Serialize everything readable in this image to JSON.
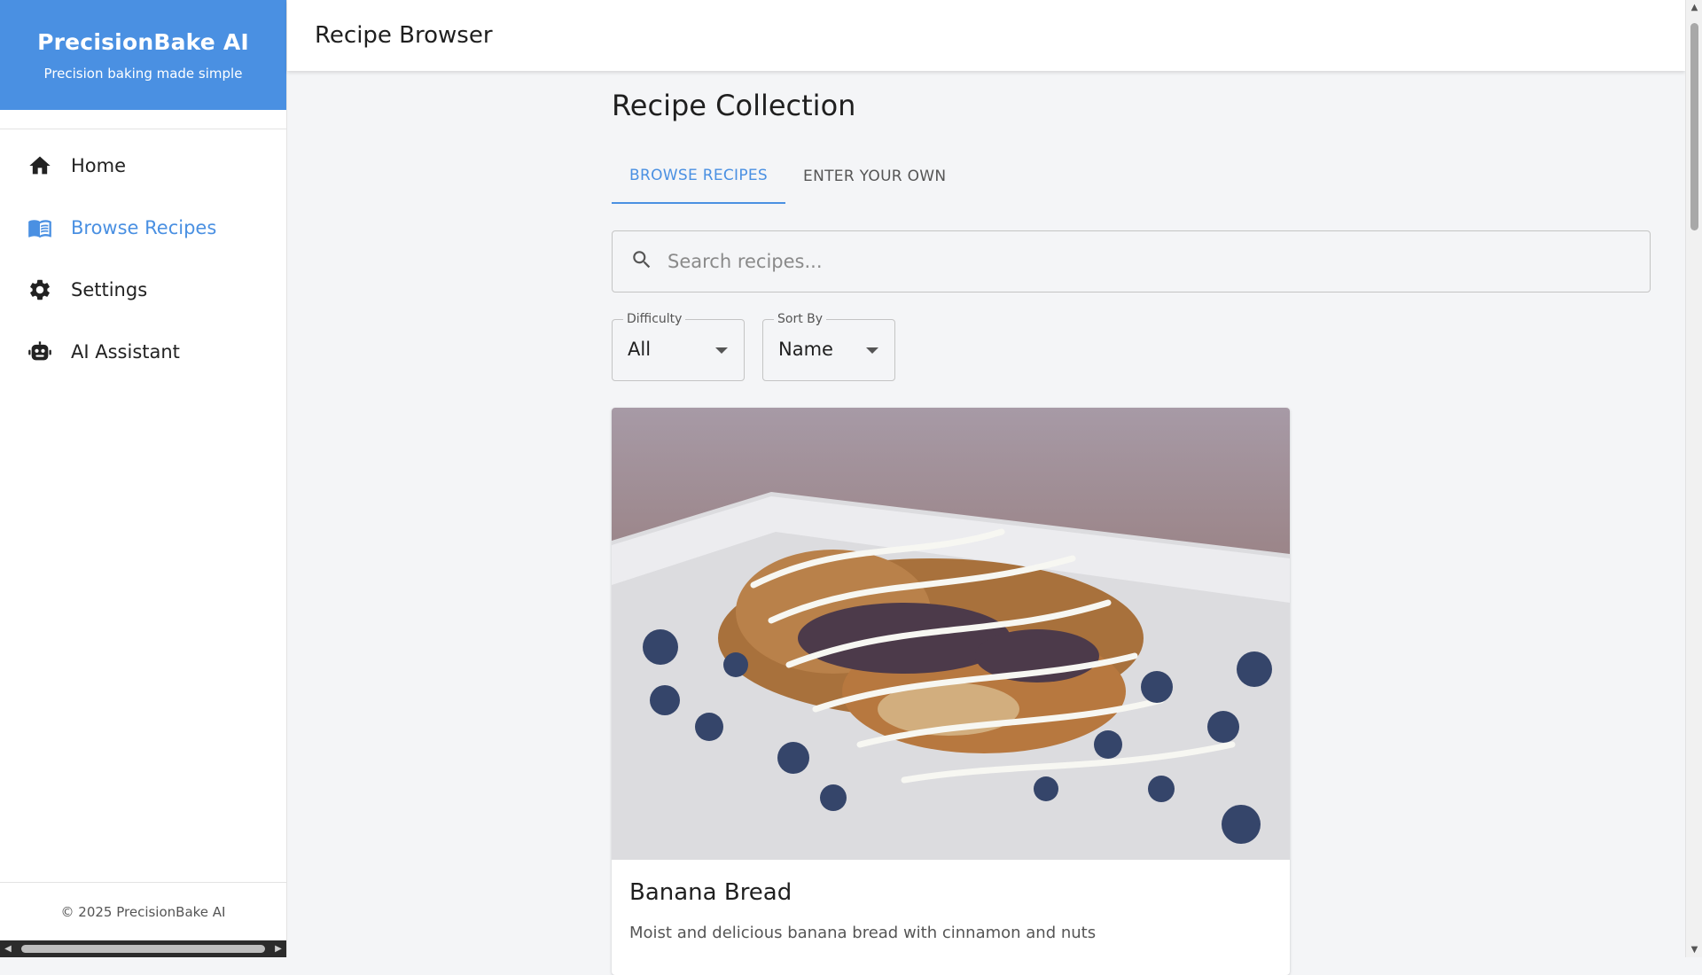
{
  "app": {
    "name": "PrecisionBake AI",
    "tagline": "Precision baking made simple",
    "footer": "© 2025 PrecisionBake AI"
  },
  "sidebar": {
    "items": [
      {
        "label": "Home",
        "icon": "home-icon",
        "active": false
      },
      {
        "label": "Browse Recipes",
        "icon": "menu-book-icon",
        "active": true
      },
      {
        "label": "Settings",
        "icon": "gear-icon",
        "active": false
      },
      {
        "label": "AI Assistant",
        "icon": "robot-icon",
        "active": false
      }
    ]
  },
  "header": {
    "title": "Recipe Browser"
  },
  "main": {
    "title": "Recipe Collection",
    "tabs": [
      {
        "label": "BROWSE RECIPES",
        "active": true
      },
      {
        "label": "ENTER YOUR OWN",
        "active": false
      }
    ],
    "search": {
      "placeholder": "Search recipes...",
      "value": ""
    },
    "filters": {
      "difficulty": {
        "label": "Difficulty",
        "value": "All"
      },
      "sort": {
        "label": "Sort By",
        "value": "Name"
      }
    },
    "recipes": [
      {
        "title": "Banana Bread",
        "description": "Moist and delicious banana bread with cinnamon and nuts"
      }
    ]
  },
  "colors": {
    "accent": "#4a90e2",
    "background": "#f4f5f7"
  }
}
